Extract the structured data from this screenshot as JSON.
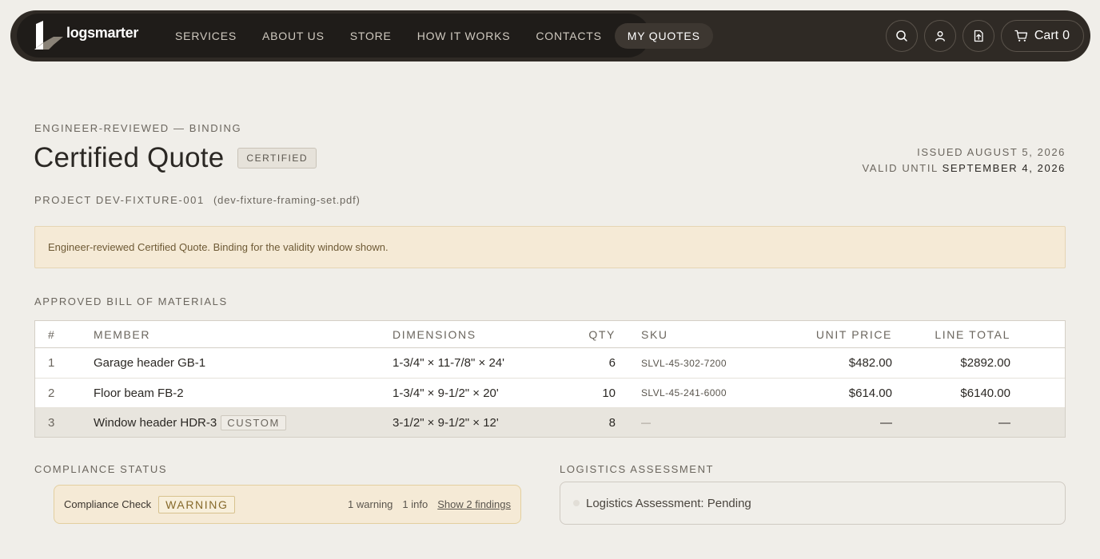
{
  "nav": {
    "brand": "logsmarter",
    "links": [
      "SERVICES",
      "ABOUT US",
      "STORE",
      "HOW IT WORKS",
      "CONTACTS",
      "MY QUOTES"
    ],
    "active": "MY QUOTES",
    "cart_label": "Cart",
    "cart_count": "0",
    "icons": [
      "search-icon",
      "user-icon",
      "file-upload-icon",
      "cart-icon"
    ]
  },
  "quote": {
    "eyebrow": "ENGINEER-REVIEWED — BINDING",
    "title": "Certified Quote",
    "badge": "CERTIFIED",
    "issued": "ISSUED AUGUST 5, 2026",
    "valid_prefix": "VALID UNTIL",
    "valid_date": "SEPTEMBER 4, 2026",
    "project": "PROJECT DEV-FIXTURE-001",
    "file": "(dev-fixture-framing-set.pdf)",
    "notice": "Engineer-reviewed Certified Quote. Binding for the validity window shown."
  },
  "bom": {
    "label": "APPROVED BILL OF MATERIALS",
    "headers": [
      "#",
      "MEMBER",
      "DIMENSIONS",
      "QTY",
      "SKU",
      "UNIT PRICE",
      "LINE TOTAL"
    ],
    "rows": [
      {
        "num": "1",
        "member": "Garage header GB-1",
        "tag": "",
        "dims": "1-3/4\" × 11-7/8\" × 24'",
        "qty": "6",
        "sku": "SLVL-45-302-7200",
        "unit": "$482.00",
        "total": "$2892.00"
      },
      {
        "num": "2",
        "member": "Floor beam FB-2",
        "tag": "",
        "dims": "1-3/4\" × 9-1/2\" × 20'",
        "qty": "10",
        "sku": "SLVL-45-241-6000",
        "unit": "$614.00",
        "total": "$6140.00"
      },
      {
        "num": "3",
        "member": "Window header HDR-3",
        "tag": "CUSTOM",
        "dims": "3-1/2\" × 9-1/2\" × 12'",
        "qty": "8",
        "sku": "—",
        "unit": "—",
        "total": "—"
      }
    ]
  },
  "compliance": {
    "label": "COMPLIANCE STATUS",
    "title": "Compliance Check",
    "badge": "WARNING",
    "warnings": "1 warning",
    "info": "1 info",
    "link": "Show 2 findings"
  },
  "logistics": {
    "label": "LOGISTICS ASSESSMENT",
    "status": "Logistics Assessment: Pending"
  }
}
